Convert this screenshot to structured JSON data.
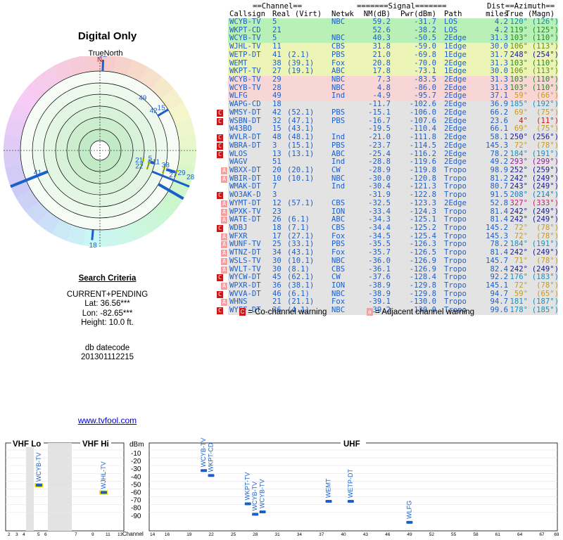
{
  "left": {
    "title": "Digital Only",
    "true_north": "TrueNorth",
    "north_marker": "N",
    "criteria_heading": "Search Criteria",
    "criteria": [
      "CURRENT+PENDING",
      "Lat: 36.56***",
      "Lon: -82.65***",
      "Height: 10.0 ft."
    ],
    "db_label": "db datecode",
    "db_value": "201301112215",
    "link": "www.tvfool.com"
  },
  "polar_labels": [
    {
      "text": "32",
      "az": 2,
      "r": 1.0
    },
    {
      "text": "49",
      "az": 39,
      "r": 0.71
    },
    {
      "text": "42",
      "az": 53,
      "r": 0.7
    },
    {
      "text": "15",
      "az": 55,
      "r": 0.78
    },
    {
      "text": "41",
      "az": 251,
      "r": 0.68
    },
    {
      "text": "21",
      "az": 103,
      "r": 0.42
    },
    {
      "text": "22",
      "az": 111,
      "r": 0.44
    },
    {
      "text": "5",
      "az": 98,
      "r": 0.55
    },
    {
      "text": "11",
      "az": 101,
      "r": 0.6
    },
    {
      "text": "38",
      "az": 102,
      "r": 0.7
    },
    {
      "text": "27",
      "az": 108,
      "r": 0.8
    },
    {
      "text": "29",
      "az": 105,
      "r": 0.88
    },
    {
      "text": "28",
      "az": 106,
      "r": 0.98
    },
    {
      "text": "18",
      "az": 184,
      "r": 0.98
    }
  ],
  "header": {
    "channel": "==Channel==",
    "signal": "=======Signal=======",
    "dist": "Dist",
    "azimuth": "==Azimuth==",
    "callsign": "Callsign",
    "real_virt": "Real (Virt)",
    "netwk": "Netwk",
    "nm": "NM(dB)",
    "pwr": "Pwr(dBm)",
    "path": "Path",
    "miles": "miles",
    "true_magn": "True (Magn)"
  },
  "stations": [
    {
      "call": "WCYB-TV",
      "real": "5",
      "virt": "",
      "net": "NBC",
      "nm": "59.2",
      "pwr": "-31.7",
      "path": "LOS",
      "dist": "4.2",
      "azt": "120°",
      "azm": "(126°)",
      "bg": "#b8f0b8",
      "color": "#1a5fcc",
      "azcolor": "#0f8a9e",
      "warn": ""
    },
    {
      "call": "WKPT-CD",
      "real": "21",
      "virt": "",
      "net": "",
      "nm": "52.6",
      "pwr": "-38.2",
      "path": "LOS",
      "dist": "4.2",
      "azt": "119°",
      "azm": "(125°)",
      "bg": "#b8f0b8",
      "color": "#1a5fcc",
      "azcolor": "#1f8c1f",
      "warn": ""
    },
    {
      "call": "WCYB-TV",
      "real": "5",
      "virt": "",
      "net": "NBC",
      "nm": "40.3",
      "pwr": "-50.5",
      "path": "2Edge",
      "dist": "31.3",
      "azt": "103°",
      "azm": "(110°)",
      "bg": "#b8f0b8",
      "color": "#1a5fcc",
      "azcolor": "#2a8a1f",
      "warn": ""
    },
    {
      "call": "WJHL-TV",
      "real": "11",
      "virt": "",
      "net": "CBS",
      "nm": "31.8",
      "pwr": "-59.0",
      "path": "1Edge",
      "dist": "30.0",
      "azt": "106°",
      "azm": "(113°)",
      "bg": "#ecf5b5",
      "color": "#1a5fcc",
      "azcolor": "#6b8a1a",
      "warn": ""
    },
    {
      "call": "WETP-DT",
      "real": "41",
      "virt": "(2.1)",
      "net": "PBS",
      "nm": "21.0",
      "pwr": "-69.8",
      "path": "1Edge",
      "dist": "31.7",
      "azt": "248°",
      "azm": "(254°)",
      "bg": "#ecf5b5",
      "color": "#1a5fcc",
      "azcolor": "#1a1a99",
      "warn": ""
    },
    {
      "call": "WEMT",
      "real": "38",
      "virt": "(39.1)",
      "net": "Fox",
      "nm": "20.8",
      "pwr": "-70.0",
      "path": "2Edge",
      "dist": "31.3",
      "azt": "103°",
      "azm": "(110°)",
      "bg": "#ecf5b5",
      "color": "#1a5fcc",
      "azcolor": "#2a8a1f",
      "warn": ""
    },
    {
      "call": "WKPT-TV",
      "real": "27",
      "virt": "(19.1)",
      "net": "ABC",
      "nm": "17.8",
      "pwr": "-73.1",
      "path": "1Edge",
      "dist": "30.0",
      "azt": "106°",
      "azm": "(113°)",
      "bg": "#ecf5b5",
      "color": "#1a5fcc",
      "azcolor": "#6b8a1a",
      "warn": ""
    },
    {
      "call": "WCYB-TV",
      "real": "29",
      "virt": "",
      "net": "NBC",
      "nm": "7.3",
      "pwr": "-83.5",
      "path": "2Edge",
      "dist": "31.3",
      "azt": "103°",
      "azm": "(110°)",
      "bg": "#f9d6d6",
      "color": "#1a5fcc",
      "azcolor": "#2a8a1f",
      "warn": ""
    },
    {
      "call": "WCYB-TV",
      "real": "28",
      "virt": "",
      "net": "NBC",
      "nm": "4.8",
      "pwr": "-86.0",
      "path": "2Edge",
      "dist": "31.3",
      "azt": "103°",
      "azm": "(110°)",
      "bg": "#f9d6d6",
      "color": "#1a5fcc",
      "azcolor": "#2a8a1f",
      "warn": ""
    },
    {
      "call": "WLFG",
      "real": "49",
      "virt": "",
      "net": "Ind",
      "nm": "-4.9",
      "pwr": "-95.7",
      "path": "2Edge",
      "dist": "37.1",
      "azt": "59°",
      "azm": "(66°)",
      "bg": "#f9d6d6",
      "color": "#1a5fcc",
      "azcolor": "#c89a1a",
      "warn": ""
    },
    {
      "call": "WAPG-CD",
      "real": "18",
      "virt": "",
      "net": "",
      "nm": "-11.7",
      "pwr": "-102.6",
      "path": "2Edge",
      "dist": "36.9",
      "azt": "185°",
      "azm": "(192°)",
      "bg": "#e3e3e3",
      "color": "#1a5fcc",
      "azcolor": "#1a8fbf",
      "warn": ""
    },
    {
      "call": "WMSY-DT",
      "real": "42",
      "virt": "(52.1)",
      "net": "PBS",
      "nm": "-15.1",
      "pwr": "-106.0",
      "path": "2Edge",
      "dist": "66.2",
      "azt": "69°",
      "azm": "(75°)",
      "bg": "#e3e3e3",
      "color": "#1a5fcc",
      "azcolor": "#c89a1a",
      "warn": "C"
    },
    {
      "call": "WSBN-DT",
      "real": "32",
      "virt": "(47.1)",
      "net": "PBS",
      "nm": "-16.7",
      "pwr": "-107.6",
      "path": "2Edge",
      "dist": "23.6",
      "azt": "4°",
      "azm": "(11°)",
      "bg": "#e3e3e3",
      "color": "#1a5fcc",
      "azcolor": "#cc1a1a",
      "warn": "C"
    },
    {
      "call": "W43BO",
      "real": "15",
      "virt": "(43.1)",
      "net": "",
      "nm": "-19.5",
      "pwr": "-110.4",
      "path": "2Edge",
      "dist": "66.1",
      "azt": "69°",
      "azm": "(75°)",
      "bg": "#e3e3e3",
      "color": "#1a5fcc",
      "azcolor": "#c89a1a",
      "warn": ""
    },
    {
      "call": "WVLR-DT",
      "real": "48",
      "virt": "(48.1)",
      "net": "Ind",
      "nm": "-21.0",
      "pwr": "-111.8",
      "path": "2Edge",
      "dist": "58.1",
      "azt": "250°",
      "azm": "(256°)",
      "bg": "#e3e3e3",
      "color": "#1a5fcc",
      "azcolor": "#1a1a99",
      "warn": "C"
    },
    {
      "call": "WBRA-DT",
      "real": "3",
      "virt": "(15.1)",
      "net": "PBS",
      "nm": "-23.7",
      "pwr": "-114.5",
      "path": "2Edge",
      "dist": "145.3",
      "azt": "72°",
      "azm": "(78°)",
      "bg": "#e3e3e3",
      "color": "#1a5fcc",
      "azcolor": "#c89a1a",
      "warn": "C"
    },
    {
      "call": "WLOS",
      "real": "13",
      "virt": "(13.1)",
      "net": "ABC",
      "nm": "-25.4",
      "pwr": "-116.2",
      "path": "2Edge",
      "dist": "78.2",
      "azt": "184°",
      "azm": "(191°)",
      "bg": "#e3e3e3",
      "color": "#1a5fcc",
      "azcolor": "#1a8fbf",
      "warn": "C"
    },
    {
      "call": "WAGV",
      "real": "51",
      "virt": "",
      "net": "Ind",
      "nm": "-28.8",
      "pwr": "-119.6",
      "path": "2Edge",
      "dist": "49.2",
      "azt": "293°",
      "azm": "(299°)",
      "bg": "#e3e3e3",
      "color": "#1a5fcc",
      "azcolor": "#a01aa0",
      "warn": ""
    },
    {
      "call": "WBXX-DT",
      "real": "20",
      "virt": "(20.1)",
      "net": "CW",
      "nm": "-28.9",
      "pwr": "-119.8",
      "path": "Tropo",
      "dist": "98.9",
      "azt": "252°",
      "azm": "(259°)",
      "bg": "#e3e3e3",
      "color": "#1a5fcc",
      "azcolor": "#1a1a99",
      "warn": "A"
    },
    {
      "call": "WBIR-DT",
      "real": "10",
      "virt": "(10.1)",
      "net": "NBC",
      "nm": "-30.0",
      "pwr": "-120.8",
      "path": "Tropo",
      "dist": "81.2",
      "azt": "242°",
      "azm": "(249°)",
      "bg": "#e3e3e3",
      "color": "#1a5fcc",
      "azcolor": "#1a1a99",
      "warn": "A"
    },
    {
      "call": "WMAK-DT",
      "real": "7",
      "virt": "",
      "net": "Ind",
      "nm": "-30.4",
      "pwr": "-121.3",
      "path": "Tropo",
      "dist": "80.7",
      "azt": "243°",
      "azm": "(249°)",
      "bg": "#e3e3e3",
      "color": "#1a5fcc",
      "azcolor": "#1a1a99",
      "warn": ""
    },
    {
      "call": "WO3AK-D",
      "real": "3",
      "virt": "",
      "net": "",
      "nm": "-31.9",
      "pwr": "-122.8",
      "path": "Tropo",
      "dist": "91.5",
      "azt": "208°",
      "azm": "(214°)",
      "bg": "#e3e3e3",
      "color": "#1a5fcc",
      "azcolor": "#1a7ac8",
      "warn": "C"
    },
    {
      "call": "WYMT-DT",
      "real": "12",
      "virt": "(57.1)",
      "net": "CBS",
      "nm": "-32.5",
      "pwr": "-123.3",
      "path": "2Edge",
      "dist": "52.8",
      "azt": "327°",
      "azm": "(333°)",
      "bg": "#e3e3e3",
      "color": "#1a5fcc",
      "azcolor": "#cc1a6a",
      "warn": "A"
    },
    {
      "call": "WPXK-TV",
      "real": "23",
      "virt": "",
      "net": "ION",
      "nm": "-33.4",
      "pwr": "-124.3",
      "path": "Tropo",
      "dist": "81.4",
      "azt": "242°",
      "azm": "(249°)",
      "bg": "#e3e3e3",
      "color": "#1a5fcc",
      "azcolor": "#1a1a99",
      "warn": "A"
    },
    {
      "call": "WATE-DT",
      "real": "26",
      "virt": "(6.1)",
      "net": "ABC",
      "nm": "-34.3",
      "pwr": "-125.1",
      "path": "Tropo",
      "dist": "81.4",
      "azt": "242°",
      "azm": "(249°)",
      "bg": "#e3e3e3",
      "color": "#1a5fcc",
      "azcolor": "#1a1a99",
      "warn": "A"
    },
    {
      "call": "WDBJ",
      "real": "18",
      "virt": "(7.1)",
      "net": "CBS",
      "nm": "-34.4",
      "pwr": "-125.2",
      "path": "Tropo",
      "dist": "145.2",
      "azt": "72°",
      "azm": "(78°)",
      "bg": "#e3e3e3",
      "color": "#1a5fcc",
      "azcolor": "#c89a1a",
      "warn": "C"
    },
    {
      "call": "WFXR",
      "real": "17",
      "virt": "(27.1)",
      "net": "Fox",
      "nm": "-34.5",
      "pwr": "-125.4",
      "path": "Tropo",
      "dist": "145.3",
      "azt": "72°",
      "azm": "(78°)",
      "bg": "#e3e3e3",
      "color": "#1a5fcc",
      "azcolor": "#c89a1a",
      "warn": "A"
    },
    {
      "call": "WUNF-TV",
      "real": "25",
      "virt": "(33.1)",
      "net": "PBS",
      "nm": "-35.5",
      "pwr": "-126.3",
      "path": "Tropo",
      "dist": "78.2",
      "azt": "184°",
      "azm": "(191°)",
      "bg": "#e3e3e3",
      "color": "#1a5fcc",
      "azcolor": "#1a8fbf",
      "warn": "A"
    },
    {
      "call": "WTNZ-DT",
      "real": "34",
      "virt": "(43.1)",
      "net": "Fox",
      "nm": "-35.7",
      "pwr": "-126.5",
      "path": "Tropo",
      "dist": "81.4",
      "azt": "242°",
      "azm": "(249°)",
      "bg": "#e3e3e3",
      "color": "#1a5fcc",
      "azcolor": "#1a1a99",
      "warn": "A"
    },
    {
      "call": "WSLS-TV",
      "real": "30",
      "virt": "(10.1)",
      "net": "NBC",
      "nm": "-36.0",
      "pwr": "-126.9",
      "path": "Tropo",
      "dist": "145.7",
      "azt": "71°",
      "azm": "(78°)",
      "bg": "#e3e3e3",
      "color": "#1a5fcc",
      "azcolor": "#c89a1a",
      "warn": "A"
    },
    {
      "call": "WVLT-TV",
      "real": "30",
      "virt": "(8.1)",
      "net": "CBS",
      "nm": "-36.1",
      "pwr": "-126.9",
      "path": "Tropo",
      "dist": "82.4",
      "azt": "242°",
      "azm": "(249°)",
      "bg": "#e3e3e3",
      "color": "#1a5fcc",
      "azcolor": "#1a1a99",
      "warn": "A"
    },
    {
      "call": "WYCW-DT",
      "real": "45",
      "virt": "(62.1)",
      "net": "CW",
      "nm": "-37.6",
      "pwr": "-128.4",
      "path": "Tropo",
      "dist": "92.2",
      "azt": "176°",
      "azm": "(183°)",
      "bg": "#e3e3e3",
      "color": "#1a5fcc",
      "azcolor": "#1a8fbf",
      "warn": "C"
    },
    {
      "call": "WPXR-DT",
      "real": "36",
      "virt": "(38.1)",
      "net": "ION",
      "nm": "-38.9",
      "pwr": "-129.8",
      "path": "Tropo",
      "dist": "145.1",
      "azt": "72°",
      "azm": "(78°)",
      "bg": "#e3e3e3",
      "color": "#1a5fcc",
      "azcolor": "#c89a1a",
      "warn": "A"
    },
    {
      "call": "WVVA-DT",
      "real": "46",
      "virt": "(6.1)",
      "net": "NBC",
      "nm": "-38.9",
      "pwr": "-129.8",
      "path": "Tropo",
      "dist": "94.7",
      "azt": "59°",
      "azm": "(65°)",
      "bg": "#e3e3e3",
      "color": "#1a5fcc",
      "azcolor": "#c89a1a",
      "warn": "C"
    },
    {
      "call": "WHNS",
      "real": "21",
      "virt": "(21.1)",
      "net": "Fox",
      "nm": "-39.1",
      "pwr": "-130.0",
      "path": "Tropo",
      "dist": "94.7",
      "azt": "181°",
      "azm": "(187°)",
      "bg": "#e3e3e3",
      "color": "#1a5fcc",
      "azcolor": "#1a8fbf",
      "warn": "A"
    },
    {
      "call": "WYFF-DT",
      "real": "36",
      "virt": "(4.1)",
      "net": "NBC",
      "nm": "-39.2",
      "pwr": "-130.0",
      "path": "Tropo",
      "dist": "99.6",
      "azt": "178°",
      "azm": "(185°)",
      "bg": "#e3e3e3",
      "color": "#1a5fcc",
      "azcolor": "#1a8fbf",
      "warn": "C"
    }
  ],
  "legend": {
    "co_badge": "C",
    "co_text": "= Co-channel warning",
    "adj_badge": "a",
    "adj_text": "= Adjacent channel warning"
  },
  "spectrum": {
    "vhf_lo": "VHF Lo",
    "vhf_hi": "VHF Hi",
    "uhf": "UHF",
    "dbm": "dBm",
    "channel": "Channel",
    "dbm_ticks": [
      "-10",
      "-20",
      "-30",
      "-40",
      "-50",
      "-60",
      "-70",
      "-80",
      "-90"
    ],
    "vhf_lo_ticks": [
      "2",
      "3",
      "4",
      "5",
      "6"
    ],
    "vhf_hi_ticks": [
      "7",
      "9",
      "11",
      "13"
    ],
    "uhf_ticks": [
      "14",
      "16",
      "19",
      "22",
      "25",
      "28",
      "31",
      "34",
      "37",
      "40",
      "43",
      "46",
      "49",
      "52",
      "55",
      "58",
      "61",
      "64",
      "67",
      "69"
    ],
    "bars": [
      {
        "label": "WCYB-TV",
        "ch": 5,
        "dbm": -50
      },
      {
        "label": "WJHL-TV",
        "ch": 11,
        "dbm": -59
      },
      {
        "label": "WCYB-TV",
        "ch": 21,
        "dbm": -32
      },
      {
        "label": "WKPT-CD",
        "ch": 22,
        "dbm": -38
      },
      {
        "label": "WKPT-TV",
        "ch": 27,
        "dbm": -73
      },
      {
        "label": "WCYB-TV",
        "ch": 28,
        "dbm": -86
      },
      {
        "label": "WCYB-TV",
        "ch": 29,
        "dbm": -83
      },
      {
        "label": "WEMT",
        "ch": 38,
        "dbm": -70
      },
      {
        "label": "WETP-DT",
        "ch": 41,
        "dbm": -70
      },
      {
        "label": "WLFG",
        "ch": 49,
        "dbm": -96
      }
    ]
  },
  "colors": {
    "accent": "#1a5fcc",
    "warn_red": "#cc1a1a",
    "warn_pink": "#e88080",
    "bar": "#1a5fcc",
    "bar_outline": "#e6e600"
  }
}
